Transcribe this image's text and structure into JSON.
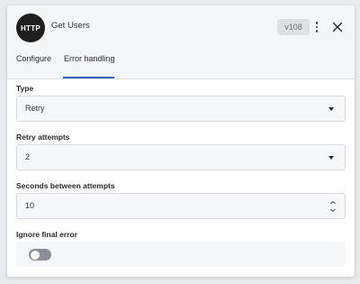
{
  "header": {
    "logo_text": "HTTP",
    "title": "Get Users",
    "version": "v108",
    "icons": {
      "menu": "more-vertical-icon",
      "close": "close-icon"
    }
  },
  "tabs": [
    {
      "label": "Configure",
      "active": false
    },
    {
      "label": "Error handling",
      "active": true
    }
  ],
  "form": {
    "type": {
      "label": "Type",
      "value": "Retry"
    },
    "retry_attempts": {
      "label": "Retry attempts",
      "value": "2"
    },
    "seconds_between": {
      "label": "Seconds between attempts",
      "value": "10"
    },
    "ignore_final_error": {
      "label": "Ignore final error",
      "enabled": false
    }
  },
  "colors": {
    "accent": "#3b5fc0",
    "toggle_off": "#8a8e94"
  }
}
